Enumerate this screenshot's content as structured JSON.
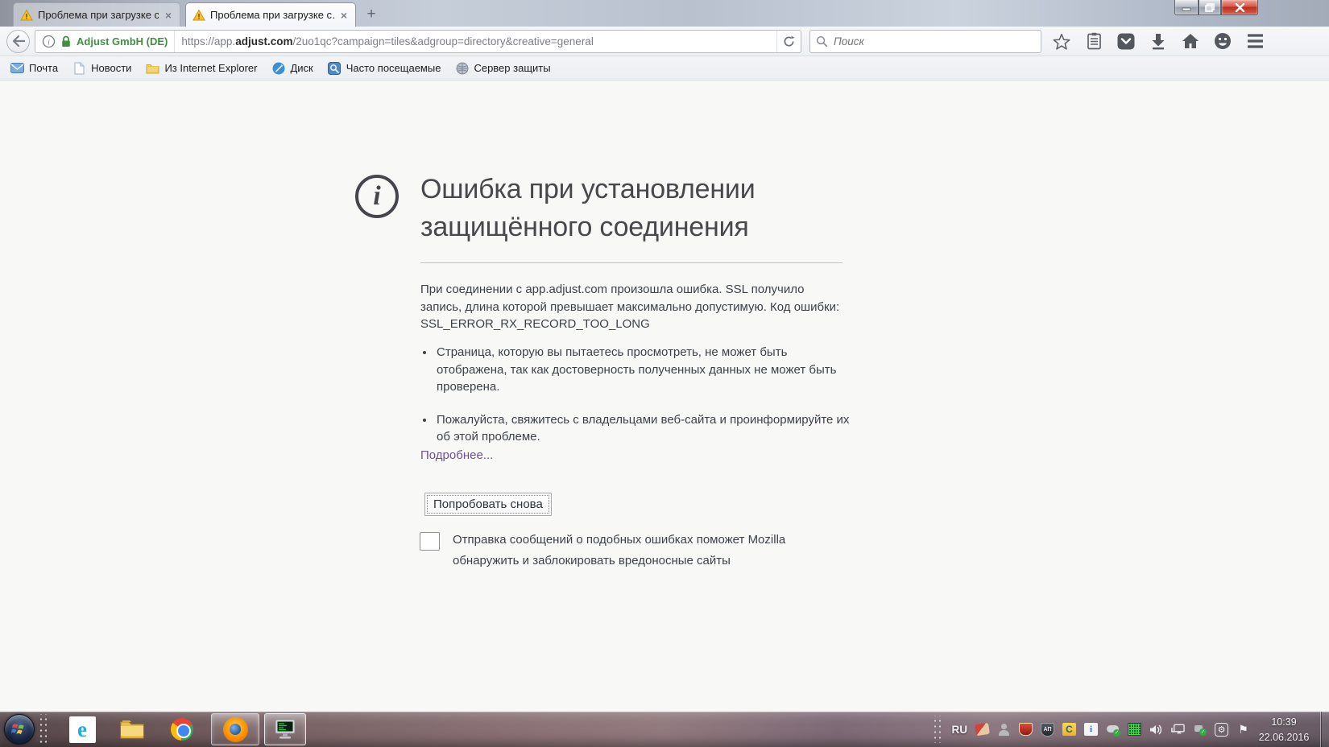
{
  "browser": {
    "tabs": [
      {
        "title": "Проблема при загрузке с…"
      },
      {
        "title": "Проблема при загрузке с…"
      }
    ],
    "identity_label": "Adjust GmbH (DE)",
    "url": {
      "scheme_host": "https://app.",
      "domain": "adjust.com",
      "path": "/2uo1qc?campaign=tiles&adgroup=directory&creative=general"
    },
    "search_placeholder": "Поиск"
  },
  "bookmarks_bar": {
    "items": [
      {
        "label": "Почта"
      },
      {
        "label": "Новости"
      },
      {
        "label": "Из Internet Explorer"
      },
      {
        "label": "Диск"
      },
      {
        "label": "Часто посещаемые"
      },
      {
        "label": "Сервер защиты"
      }
    ]
  },
  "error_page": {
    "title": "Ошибка при установлении защищённого соединения",
    "description": "При соединении с app.adjust.com произошла ошибка. SSL получило запись, длина которой превышает максимально допустимую. Код ошибки: SSL_ERROR_RX_RECORD_TOO_LONG",
    "bullets": [
      "Страница, которую вы пытаетесь просмотреть, не может быть отображена, так как достоверность полученных данных не может быть проверена.",
      "Пожалуйста, свяжитесь с владельцами веб-сайта и проинформируйте их об этой проблеме."
    ],
    "learn_more_label": "Подробнее...",
    "retry_button_label": "Попробовать снова",
    "report_label": "Отправка сообщений о подобных ошибках поможет Mozilla обнаружить и заблокировать вредоносные сайты"
  },
  "taskbar": {
    "language_indicator": "RU",
    "clock": {
      "time": "10:39",
      "date": "22.06.2016"
    }
  },
  "colors": {
    "identity_green": "#3f9140",
    "visited_link": "#6d4f9c",
    "close_button_red": "#cf3b2d",
    "error_title_gray": "#47474c"
  }
}
